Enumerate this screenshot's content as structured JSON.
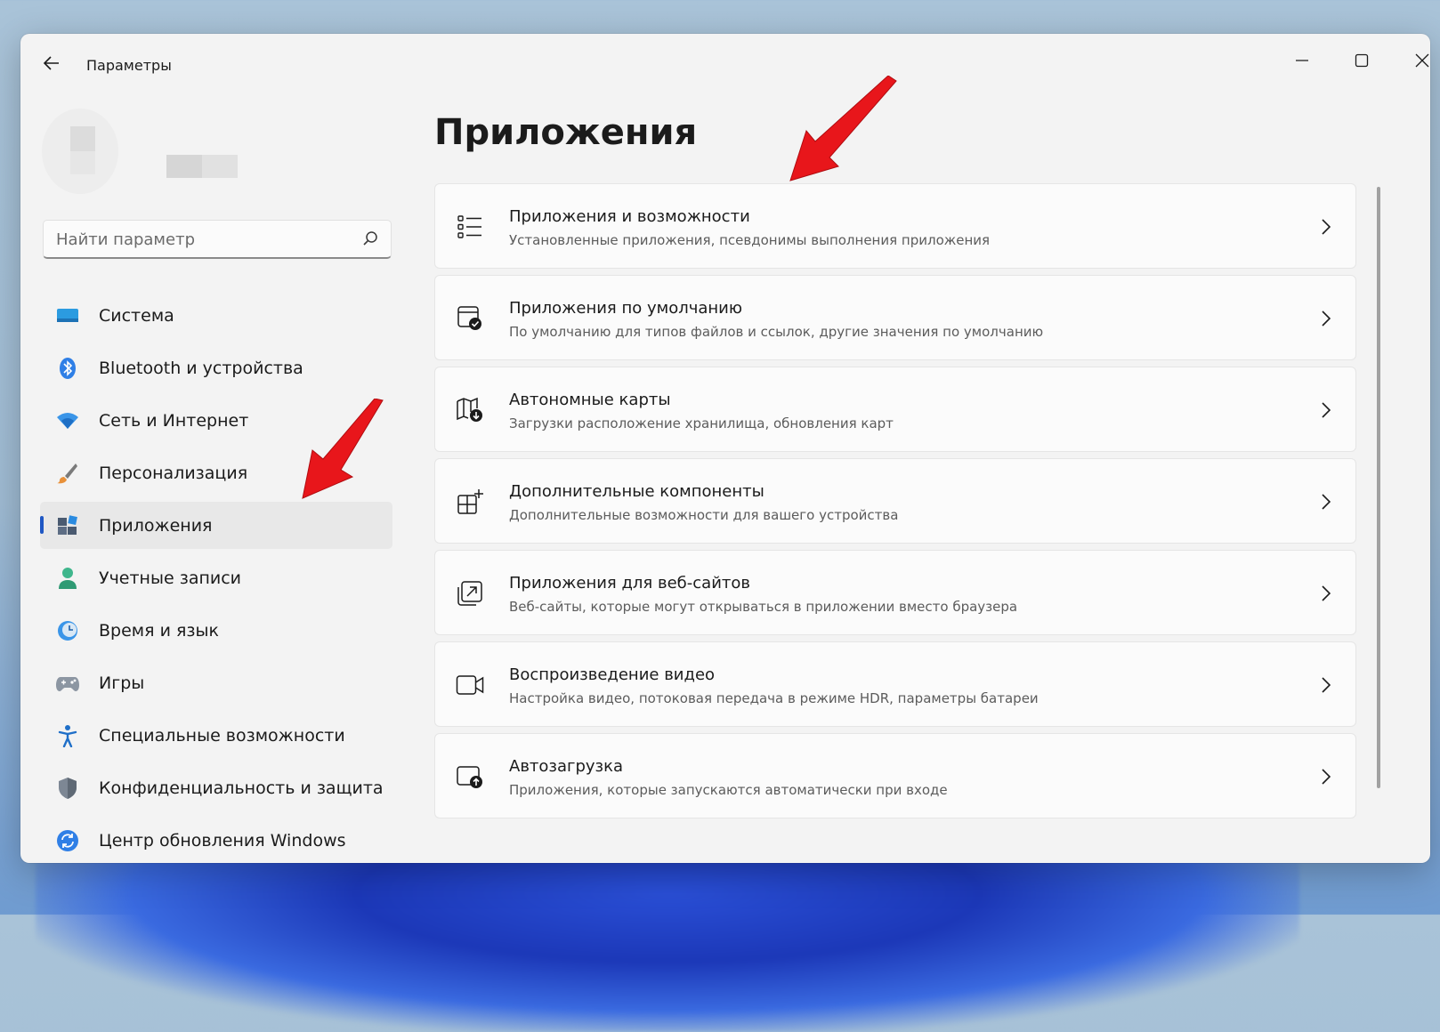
{
  "window": {
    "title": "Параметры"
  },
  "search": {
    "placeholder": "Найти параметр"
  },
  "sidebar": {
    "items": [
      {
        "label": "Система",
        "icon": "display-icon",
        "active": false
      },
      {
        "label": "Bluetooth и устройства",
        "icon": "bluetooth-icon",
        "active": false
      },
      {
        "label": "Сеть и Интернет",
        "icon": "wifi-icon",
        "active": false
      },
      {
        "label": "Персонализация",
        "icon": "brush-icon",
        "active": false
      },
      {
        "label": "Приложения",
        "icon": "apps-icon",
        "active": true
      },
      {
        "label": "Учетные записи",
        "icon": "person-icon",
        "active": false
      },
      {
        "label": "Время и язык",
        "icon": "clock-globe-icon",
        "active": false
      },
      {
        "label": "Игры",
        "icon": "gamepad-icon",
        "active": false
      },
      {
        "label": "Специальные возможности",
        "icon": "accessibility-icon",
        "active": false
      },
      {
        "label": "Конфиденциальность и защита",
        "icon": "shield-icon",
        "active": false
      },
      {
        "label": "Центр обновления Windows",
        "icon": "update-icon",
        "active": false
      }
    ]
  },
  "main": {
    "title": "Приложения",
    "cards": [
      {
        "title": "Приложения и возможности",
        "desc": "Установленные приложения, псевдонимы выполнения приложения",
        "icon": "list-icon"
      },
      {
        "title": "Приложения по умолчанию",
        "desc": "По умолчанию для типов файлов и ссылок, другие значения по умолчанию",
        "icon": "default-apps-icon"
      },
      {
        "title": "Автономные карты",
        "desc": "Загрузки расположение хранилища, обновления карт",
        "icon": "offline-map-icon"
      },
      {
        "title": "Дополнительные компоненты",
        "desc": "Дополнительные возможности для вашего устройства",
        "icon": "add-component-icon"
      },
      {
        "title": "Приложения для веб-сайтов",
        "desc": "Веб-сайты, которые могут открываться в приложении вместо браузера",
        "icon": "web-app-icon"
      },
      {
        "title": "Воспроизведение видео",
        "desc": "Настройка видео, потоковая передача в режиме HDR, параметры батареи",
        "icon": "video-icon"
      },
      {
        "title": "Автозагрузка",
        "desc": "Приложения, которые запускаются автоматически при входе",
        "icon": "startup-icon"
      }
    ]
  },
  "colors": {
    "accent": "#1f57c4",
    "annotation_arrow": "#e8161b"
  }
}
